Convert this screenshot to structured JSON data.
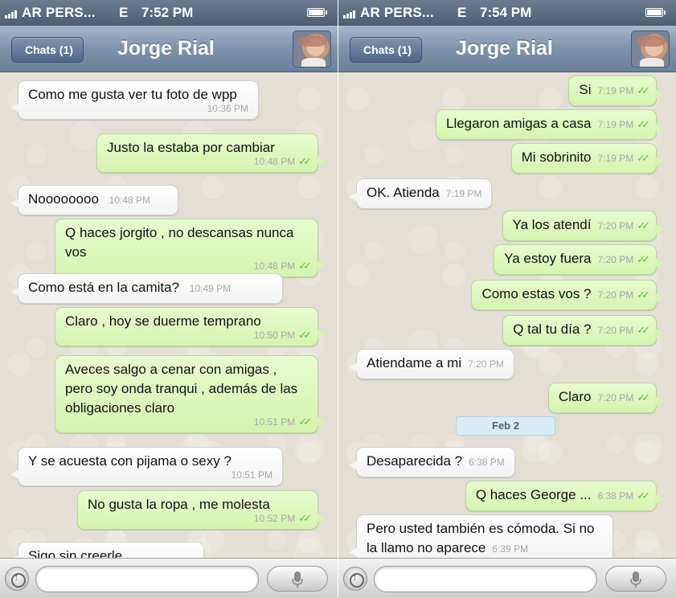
{
  "phones": [
    {
      "status": {
        "carrier": "AR PERS...",
        "network": "E",
        "time": "7:52 PM"
      },
      "nav": {
        "back_label": "Chats (1)",
        "contact_name": "Jorge Rial"
      },
      "messages": [
        {
          "dir": "in",
          "text": "Como me gusta ver tu foto de wpp",
          "time": "10:36 PM"
        },
        {
          "dir": "out",
          "text": "Justo la estaba por cambiar",
          "time": "10:48 PM"
        },
        {
          "dir": "in",
          "text": "Noooooooo",
          "time": "10:48 PM"
        },
        {
          "dir": "out",
          "text": "Q haces jorgito , no descansas nunca vos",
          "time": "10:48 PM"
        },
        {
          "dir": "in",
          "text": "Como está en la camita?",
          "time": "10:49 PM"
        },
        {
          "dir": "out",
          "text": "Claro , hoy se duerme temprano",
          "time": "10:50 PM"
        },
        {
          "dir": "out",
          "text": "Aveces salgo a cenar con amigas , pero soy onda tranqui , además de las obligaciones claro",
          "time": "10:51 PM"
        },
        {
          "dir": "in",
          "text": "Y se acuesta con pijama o sexy ?",
          "time": "10:51 PM"
        },
        {
          "dir": "out",
          "text": "No gusta la ropa , me molesta",
          "time": "10:52 PM"
        },
        {
          "dir": "in",
          "text": "Sigo sin creerle",
          "time": ""
        }
      ]
    },
    {
      "status": {
        "carrier": "AR PERS...",
        "network": "E",
        "time": "7:54 PM"
      },
      "nav": {
        "back_label": "Chats (1)",
        "contact_name": "Jorge Rial"
      },
      "date_separator": "Feb 2",
      "messages": [
        {
          "dir": "out",
          "text": "Si",
          "time": "7:19 PM"
        },
        {
          "dir": "out",
          "text": "Llegaron amigas a casa",
          "time": "7:19 PM"
        },
        {
          "dir": "out",
          "text": "Mi sobrinito",
          "time": "7:19 PM"
        },
        {
          "dir": "in",
          "text": "OK. Atienda",
          "time": "7:19 PM"
        },
        {
          "dir": "out",
          "text": "Ya los atendí",
          "time": "7:20 PM"
        },
        {
          "dir": "out",
          "text": "Ya estoy fuera",
          "time": "7:20 PM"
        },
        {
          "dir": "out",
          "text": "Como estas vos ?",
          "time": "7:20 PM"
        },
        {
          "dir": "out",
          "text": "Q tal tu día ?",
          "time": "7:20 PM"
        },
        {
          "dir": "in",
          "text": "Atiendame a mi",
          "time": "7:20 PM"
        },
        {
          "dir": "out",
          "text": "Claro",
          "time": "7:20 PM"
        },
        {
          "dir": "in",
          "text": "Desaparecida ?",
          "time": "6:38 PM"
        },
        {
          "dir": "out",
          "text": "Q haces George ...",
          "time": "6:38 PM"
        },
        {
          "dir": "in",
          "text": "Pero usted también es cómoda. Si no la llamo no aparece",
          "time": "6:39 PM"
        }
      ]
    }
  ],
  "ticks_glyph": "✓✓",
  "colors": {
    "outgoing_bubble": "#d4f4b0",
    "incoming_bubble": "#ffffff",
    "read_ticks": "#5ec03f",
    "navbar": "#7d92ab"
  }
}
